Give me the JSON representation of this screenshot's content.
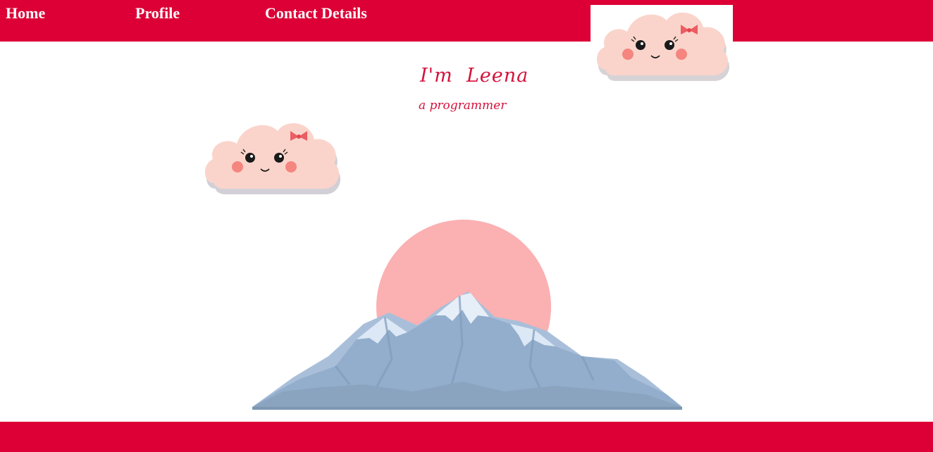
{
  "nav": {
    "home_label": "Home",
    "profile_label": "Profile",
    "contact_label": "Contact Details"
  },
  "hero": {
    "title": "I'm  Leena",
    "subtitle": "a programmer"
  },
  "images": {
    "top_cloud": "cute-cloud-illustration",
    "left_cloud": "cute-cloud-illustration",
    "scene": "mountain-sunset-illustration"
  },
  "colors": {
    "brand": "#dc0036",
    "title_text": "#d4123c",
    "sun": "#fbb0b2",
    "mountain": "#93aecc",
    "snow": "#dce8f5",
    "cloud": "#fad4cb"
  }
}
